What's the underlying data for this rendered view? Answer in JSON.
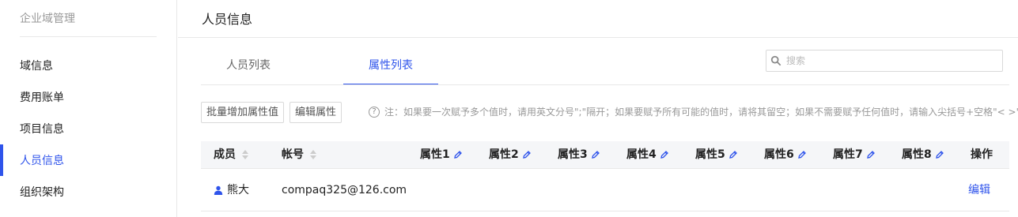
{
  "sidebar": {
    "header": "企业域管理",
    "items": [
      {
        "label": "域信息"
      },
      {
        "label": "费用账单"
      },
      {
        "label": "项目信息"
      },
      {
        "label": "人员信息"
      },
      {
        "label": "组织架构"
      }
    ],
    "active_index": 3
  },
  "main": {
    "title": "人员信息",
    "tabs": [
      {
        "label": "人员列表"
      },
      {
        "label": "属性列表"
      }
    ],
    "active_tab": 1,
    "search": {
      "placeholder": "搜索",
      "value": ""
    },
    "buttons": {
      "bulk_add": "批量增加属性值",
      "edit_attr": "编辑属性"
    },
    "note": "注：如果要一次赋予多个值时，请用英文分号\";\"隔开；如果要赋予所有可能的值时，请将其留空；如果不需要赋予任何值时，请输入尖括号+空格\"< >\"",
    "table": {
      "columns": [
        "成员",
        "帐号",
        "属性1",
        "属性2",
        "属性3",
        "属性4",
        "属性5",
        "属性6",
        "属性7",
        "属性8",
        "操作"
      ],
      "rows": [
        {
          "member": "熊大",
          "account": "compaq325@126.com",
          "action": "编辑"
        }
      ]
    }
  },
  "colors": {
    "accent": "#2f54eb",
    "border": "#e8e8e8",
    "header_bg": "#f5f6f8"
  },
  "icons": [
    "search-icon",
    "question-icon",
    "sort-icon",
    "pencil-icon",
    "user-icon"
  ]
}
